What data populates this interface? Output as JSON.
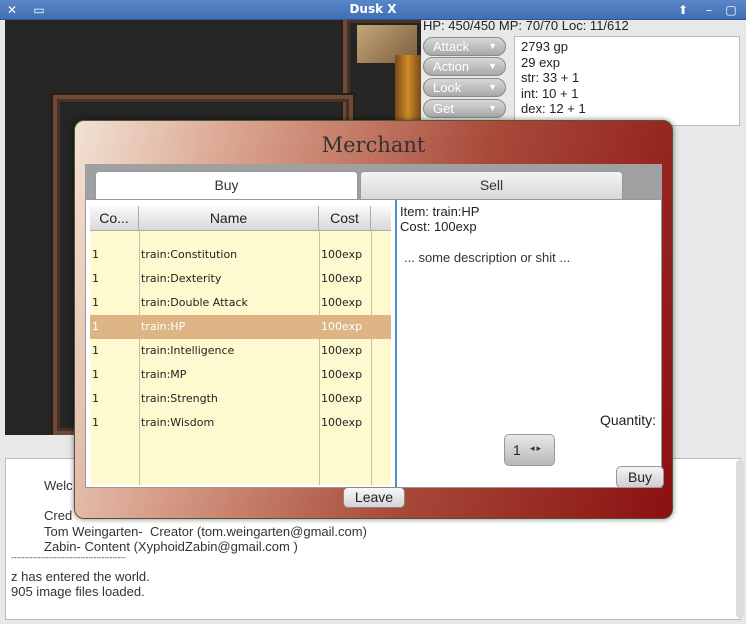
{
  "window": {
    "title": "Dusk X",
    "close_glyph": "✕",
    "menu_glyph": "▭",
    "up_glyph": "⬆",
    "min_glyph": "–",
    "max_glyph": "▢"
  },
  "status": "HP: 450/450 MP: 70/70 Loc: 11/612",
  "commands": [
    {
      "label": "Attack"
    },
    {
      "label": "Action"
    },
    {
      "label": "Look"
    },
    {
      "label": "Get"
    }
  ],
  "stats": [
    "2793 gp",
    "29 exp",
    "str: 33 + 1",
    "int: 10 + 1",
    "dex: 12 + 1"
  ],
  "chat": {
    "lines": [
      "Welc",
      "Cred",
      "Tom Weingarten-  Creator (tom.weingarten@gmail.com)",
      "Zabin- Content (XyphoidZabin@gmail.com )",
      "-------------------------------------------",
      "z has entered the world.",
      "905 image files loaded."
    ]
  },
  "merchant": {
    "title": "Merchant",
    "tabs": [
      {
        "label": "Buy"
      },
      {
        "label": "Sell"
      }
    ],
    "columns": [
      "Co...",
      "Name",
      "Cost"
    ],
    "items": [
      {
        "count": "1",
        "name": "train:Constitution",
        "cost": "100exp"
      },
      {
        "count": "1",
        "name": "train:Dexterity",
        "cost": "100exp"
      },
      {
        "count": "1",
        "name": "train:Double Attack",
        "cost": "100exp"
      },
      {
        "count": "1",
        "name": "train:HP",
        "cost": "100exp"
      },
      {
        "count": "1",
        "name": "train:Intelligence",
        "cost": "100exp"
      },
      {
        "count": "1",
        "name": "train:MP",
        "cost": "100exp"
      },
      {
        "count": "1",
        "name": "train:Strength",
        "cost": "100exp"
      },
      {
        "count": "1",
        "name": "train:Wisdom",
        "cost": "100exp"
      }
    ],
    "selected_index": 3,
    "detail": "Item: train:HP\nCost: 100exp",
    "description": "... some description or shit ...",
    "quantity_label": "Quantity:",
    "quantity": "1",
    "buy_label": "Buy",
    "leave_label": "Leave"
  }
}
